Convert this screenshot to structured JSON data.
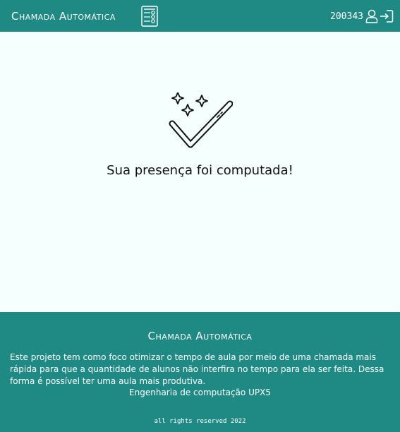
{
  "header": {
    "brand": "Chamada Automática",
    "brand_icon": "checklist-icon",
    "user_id": "200343",
    "user_icon": "user-icon",
    "logout_icon": "logout-icon"
  },
  "main": {
    "illustration_icon": "sparkle-double-check-icon",
    "message": "Sua presença foi computada!"
  },
  "footer": {
    "title": "Chamada Automática",
    "description": "Este projeto tem como foco otimizar o tempo de aula por meio de uma chamada mais rápida para que a quantidade de alunos não interfira no tempo para ela ser feita. Dessa forma é possível ter uma aula mais produtiva.",
    "course": "Engenharia de computação UPX5",
    "rights": "all rights reserved 2022"
  },
  "colors": {
    "primary": "#1F8A84",
    "background": "#F5FFFE",
    "text_light": "#FFFFFF",
    "text_dark": "#111111"
  }
}
